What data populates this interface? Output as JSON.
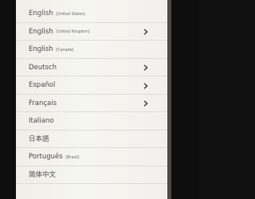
{
  "languages": [
    {
      "name": "English",
      "region": "[United States]",
      "has_submenu": false
    },
    {
      "name": "English",
      "region": "[United Kingdom]",
      "has_submenu": true
    },
    {
      "name": "English",
      "region": "[Canada]",
      "has_submenu": false
    },
    {
      "name": "Deutsch",
      "region": "",
      "has_submenu": true
    },
    {
      "name": "Español",
      "region": "",
      "has_submenu": true
    },
    {
      "name": "Français",
      "region": "",
      "has_submenu": true
    },
    {
      "name": "Italiano",
      "region": "",
      "has_submenu": false
    },
    {
      "name": "日本語",
      "region": "",
      "has_submenu": false
    },
    {
      "name": "Português",
      "region": "[Brasil]",
      "has_submenu": false
    },
    {
      "name": "简体中文",
      "region": "",
      "has_submenu": false
    }
  ],
  "colors": {
    "background": "#f3f2ed",
    "text": "#4a4a4a",
    "divider": "#dddcd6",
    "bezel": "#0e0e0e"
  },
  "icons": {
    "submenu": "chevron-right-icon"
  }
}
